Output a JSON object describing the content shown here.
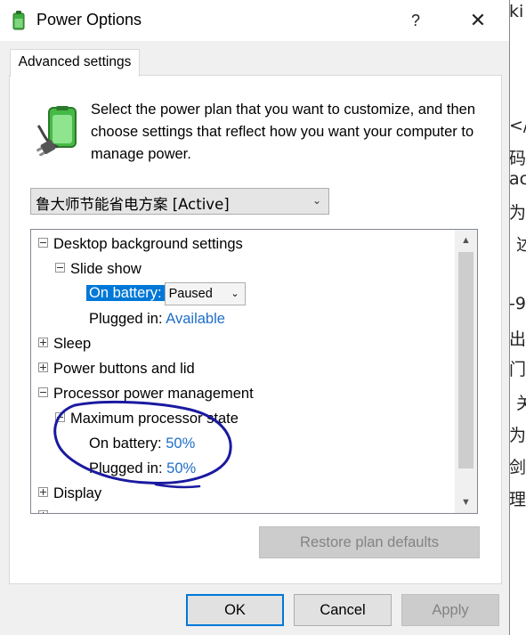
{
  "background_text": [
    "ki",
    "</",
    "码",
    "ac",
    "为",
    "述",
    "-9",
    "出",
    "门",
    "关",
    "为",
    "剑",
    "理"
  ],
  "window": {
    "title": "Power Options",
    "help": "?",
    "close": "✕"
  },
  "tab": {
    "label": "Advanced settings"
  },
  "description": "Select the power plan that you want to customize, and then choose settings that reflect how you want your computer to manage power.",
  "plan": {
    "selected": "鲁大师节能省电方案 [Active]"
  },
  "tree": {
    "desktop_bg": "Desktop background settings",
    "slide_show": "Slide show",
    "slide_on_battery_label": "On battery:",
    "slide_on_battery_value": "Paused",
    "slide_plugged_label": "Plugged in:",
    "slide_plugged_value": "Available",
    "sleep": "Sleep",
    "power_buttons": "Power buttons and lid",
    "processor_pm": "Processor power management",
    "max_processor": "Maximum processor state",
    "max_on_battery_label": "On battery:",
    "max_on_battery_value": "50%",
    "max_plugged_label": "Plugged in:",
    "max_plugged_value": "50%",
    "display": "Display"
  },
  "buttons": {
    "restore": "Restore plan defaults",
    "ok": "OK",
    "cancel": "Cancel",
    "apply": "Apply"
  },
  "colors": {
    "accent": "#0078d7",
    "link": "#1e6ec8",
    "annotation_ink": "#1a1aa0"
  }
}
